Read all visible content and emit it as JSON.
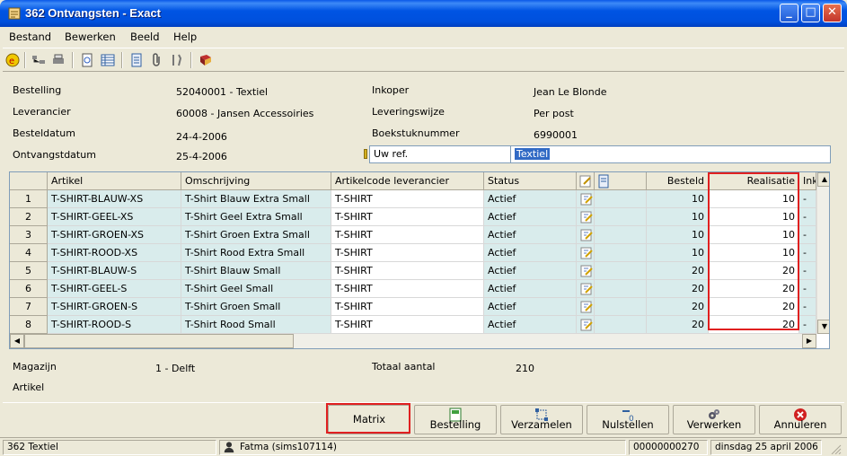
{
  "window": {
    "title": "362 Ontvangsten - Exact",
    "minimize": "_",
    "maximize": "□",
    "close": "✕"
  },
  "menu": [
    "Bestand",
    "Bewerken",
    "Beeld",
    "Help"
  ],
  "toolbar_icons": [
    "exact-logo-icon",
    "tree-icon",
    "printer-icon",
    "preview-icon",
    "list-icon",
    "document-icon",
    "attach-icon",
    "tools-icon",
    "book-icon"
  ],
  "form": {
    "bestelling_label": "Bestelling",
    "bestelling_value": "52040001 - Textiel",
    "leverancier_label": "Leverancier",
    "leverancier_value": "60008 - Jansen Accessoiries",
    "besteldatum_label": "Besteldatum",
    "besteldatum_value": "24-4-2006",
    "ontvangstdatum_label": "Ontvangstdatum",
    "ontvangstdatum_value": "25-4-2006",
    "inkoper_label": "Inkoper",
    "inkoper_value": "Jean Le Blonde",
    "leveringswijze_label": "Leveringswijze",
    "leveringswijze_value": "Per post",
    "boekstuknummer_label": "Boekstuknummer",
    "boekstuknummer_value": "6990001",
    "uwref_label": "Uw ref.",
    "uwref_value": "Textiel"
  },
  "grid": {
    "headers": [
      "Artikel",
      "Omschrijving",
      "Artikelcode leverancier",
      "Status",
      "",
      "",
      "Besteld",
      "Realisatie",
      "Ink"
    ],
    "rows": [
      {
        "nr": "1",
        "artikel": "T-SHIRT-BLAUW-XS",
        "omschrijving": "T-Shirt Blauw Extra Small",
        "code": "T-SHIRT",
        "status": "Actief",
        "besteld": "10",
        "realisatie": "10",
        "ink": "-"
      },
      {
        "nr": "2",
        "artikel": "T-SHIRT-GEEL-XS",
        "omschrijving": "T-Shirt Geel Extra Small",
        "code": "T-SHIRT",
        "status": "Actief",
        "besteld": "10",
        "realisatie": "10",
        "ink": "-"
      },
      {
        "nr": "3",
        "artikel": "T-SHIRT-GROEN-XS",
        "omschrijving": "T-Shirt Groen Extra Small",
        "code": "T-SHIRT",
        "status": "Actief",
        "besteld": "10",
        "realisatie": "10",
        "ink": "-"
      },
      {
        "nr": "4",
        "artikel": "T-SHIRT-ROOD-XS",
        "omschrijving": "T-Shirt Rood Extra Small",
        "code": "T-SHIRT",
        "status": "Actief",
        "besteld": "10",
        "realisatie": "10",
        "ink": "-"
      },
      {
        "nr": "5",
        "artikel": "T-SHIRT-BLAUW-S",
        "omschrijving": "T-Shirt Blauw Small",
        "code": "T-SHIRT",
        "status": "Actief",
        "besteld": "20",
        "realisatie": "20",
        "ink": "-"
      },
      {
        "nr": "6",
        "artikel": "T-SHIRT-GEEL-S",
        "omschrijving": "T-Shirt Geel Small",
        "code": "T-SHIRT",
        "status": "Actief",
        "besteld": "20",
        "realisatie": "20",
        "ink": "-"
      },
      {
        "nr": "7",
        "artikel": "T-SHIRT-GROEN-S",
        "omschrijving": "T-Shirt Groen Small",
        "code": "T-SHIRT",
        "status": "Actief",
        "besteld": "20",
        "realisatie": "20",
        "ink": "-"
      },
      {
        "nr": "8",
        "artikel": "T-SHIRT-ROOD-S",
        "omschrijving": "T-Shirt Rood Small",
        "code": "T-SHIRT",
        "status": "Actief",
        "besteld": "20",
        "realisatie": "20",
        "ink": "-"
      }
    ]
  },
  "footer": {
    "magazijn_label": "Magazijn",
    "magazijn_value": "1 - Delft",
    "artikel_label": "Artikel",
    "totaal_label": "Totaal aantal",
    "totaal_value": "210"
  },
  "buttons": [
    "Matrix",
    "Bestelling",
    "Verzamelen",
    "Nulstellen",
    "Verwerken",
    "Annuleren"
  ],
  "status": {
    "left": "362 Textiel",
    "user": "Fatma (sims107114)",
    "number": "00000000270",
    "date": "dinsdag 25 april 2006"
  },
  "colors": {
    "titlebar": "#0054E3",
    "row_shade": "#D9ECEC",
    "highlight": "#E02020",
    "selection": "#316AC5"
  }
}
